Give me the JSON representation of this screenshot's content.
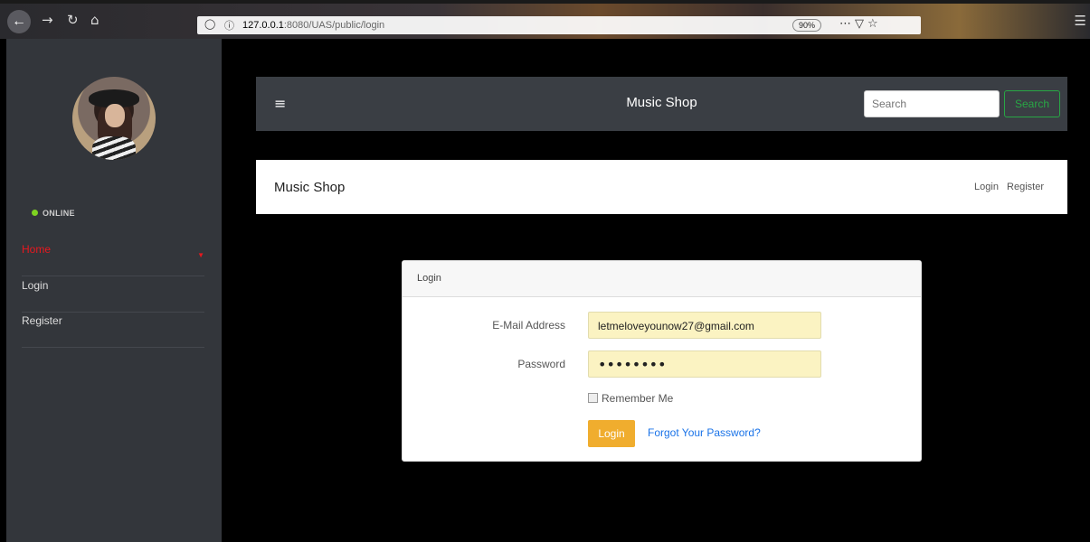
{
  "browser": {
    "url_host": "127.0.0.1",
    "url_path": ":8080/UAS/public/login",
    "zoom": "90%"
  },
  "sidebar": {
    "status": "ONLINE",
    "items": [
      {
        "label": "Home"
      },
      {
        "label": "Login"
      },
      {
        "label": "Register"
      }
    ]
  },
  "navbar": {
    "brand": "Music Shop",
    "search_placeholder": "Search",
    "search_button": "Search"
  },
  "subbar": {
    "brand": "Music Shop",
    "links": [
      "Login",
      "Register"
    ]
  },
  "login_card": {
    "title": "Login",
    "email_label": "E-Mail Address",
    "email_value": "letmeloveyounow27@gmail.com",
    "password_label": "Password",
    "password_mask": "••••••••",
    "remember_label": "Remember Me",
    "login_button": "Login",
    "forgot_link": "Forgot Your Password?"
  },
  "colors": {
    "accent_active": "#e8181f",
    "search_green": "#28a745",
    "login_orange": "#f0ad2e",
    "link_blue": "#1a73e8",
    "online_green": "#7ed321"
  }
}
